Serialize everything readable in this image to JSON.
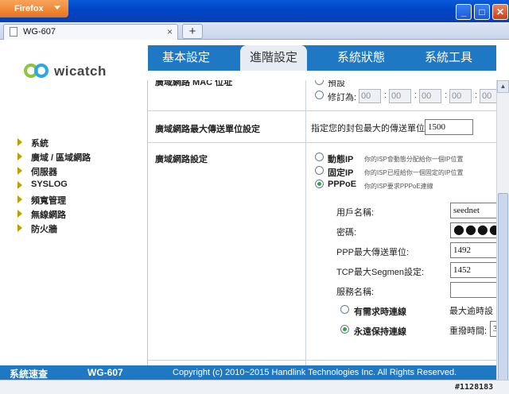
{
  "browser": {
    "menu_label": "Firefox",
    "tab_title": "WG-607",
    "new_tab": "+",
    "minimize": "_",
    "maximize": "□",
    "close": "✕",
    "tab_close": "×"
  },
  "logo": {
    "text": "wicatch",
    "icon": "wicatch-logo-icon"
  },
  "nav": {
    "tabs": [
      {
        "label": "基本設定",
        "active": false
      },
      {
        "label": "進階設定",
        "active": true
      },
      {
        "label": "系統狀態",
        "active": false
      },
      {
        "label": "系統工具",
        "active": false
      }
    ]
  },
  "sidebar": {
    "items": [
      {
        "label": "系統"
      },
      {
        "label": "廣域 / 區域網路"
      },
      {
        "label": "伺服器"
      },
      {
        "label": "SYSLOG"
      },
      {
        "label": "頻寬管理"
      },
      {
        "label": "無線網路"
      },
      {
        "label": "防火牆"
      }
    ]
  },
  "wan_mac": {
    "label": "廣域網路 MAC 位址",
    "default_option": "預設",
    "modify_option": "修訂為:",
    "mac_fields": [
      "00",
      "00",
      "00",
      "00",
      "00",
      "00"
    ]
  },
  "mtu": {
    "label": "廣域網路最大傳送單位設定",
    "prompt": "指定您的封包最大的傳送單位:",
    "value": "1500"
  },
  "wan_settings": {
    "label": "廣域網路設定",
    "options": [
      {
        "label": "動態IP",
        "hint": "你的ISP會動態分配給你一個IP位置",
        "selected": false
      },
      {
        "label": "固定IP",
        "hint": "你的ISP已經給你一個固定的IP位置",
        "selected": false
      },
      {
        "label": "PPPoE",
        "hint": "你的ISP要求PPPoE連線",
        "selected": true
      }
    ]
  },
  "pppoe": {
    "username_label": "用戶名稱:",
    "username_value": "seednet",
    "password_label": "密碼:",
    "password_value": "●●●●●",
    "ppp_mtu_label": "PPP最大傳送單位:",
    "ppp_mtu_value": "1492",
    "tcp_mss_label": "TCP最大Segmen設定:",
    "tcp_mss_value": "1452",
    "service_name_label": "服務名稱:",
    "service_name_value": "",
    "on_demand_label": "有需求時連線",
    "on_demand_selected": false,
    "max_idle_label": "最大逾時設",
    "keep_alive_label": "永遠保持連線",
    "keep_alive_selected": true,
    "redial_label": "重撥時間:",
    "redial_value": "3"
  },
  "footer": {
    "brand": "系統速查",
    "model": "WG-607",
    "copyright": "Copyright (c) 2010~2015 Handlink Technologies Inc. All Rights Reserved."
  },
  "watermark": "#1128183",
  "colors": {
    "nav_blue": "#1f78c4",
    "radio_green": "#2ba84a"
  }
}
